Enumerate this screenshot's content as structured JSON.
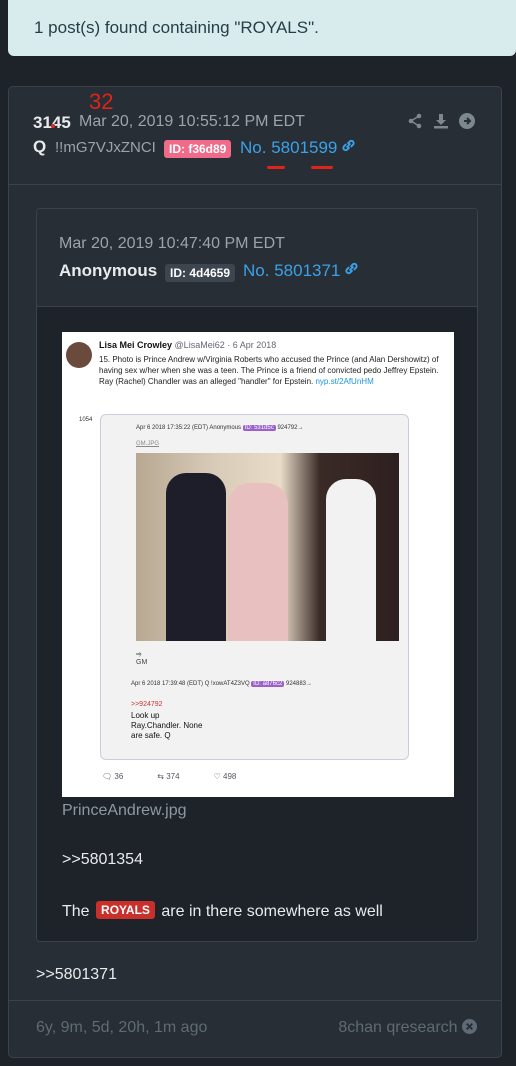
{
  "banner": {
    "text": "1 post(s) found containing \"ROYALS\"."
  },
  "post": {
    "number": "3145",
    "annotation_number": "32",
    "date": "Mar 20, 2019 10:55:12 PM EDT",
    "author": "Q",
    "tripcode": "!!mG7VJxZNCI",
    "id": "ID: f36d89",
    "post_no_label": "No.",
    "post_no": "5801599",
    "reply_link": ">>5801371",
    "footer_ago": "6y, 9m, 5d, 20h, 1m ago",
    "footer_source": "8chan qresearch"
  },
  "quoted": {
    "date": "Mar 20, 2019 10:47:40 PM EDT",
    "author": "Anonymous",
    "id": "ID: 4d4659",
    "post_no_label": "No.",
    "post_no": "5801371",
    "filename": "PrinceAndrew.jpg",
    "reply": ">>5801354",
    "text_before": "The",
    "highlight": "ROYALS",
    "text_after": "are in there somewhere as well"
  },
  "tweet": {
    "name": "Lisa Mei Crowley",
    "handle": "@LisaMei62 · 6 Apr 2018",
    "body": "15. Photo is Prince Andrew w/Virginia Roberts who accused the Prince (and Alan Dershowitz) of having sex w/her when she was a teen. The Prince is a friend of convicted pedo Jeffrey Epstein. Ray (Rachel) Chandler was an alleged \"handler\" for Epstein.",
    "link": "nyp.st/2AfUnHM",
    "card_no": "1054",
    "card_head": "Apr 6 2018 17:35:22 (EDT) Anonymous",
    "card_id": "ID: 531d5c",
    "card_ref": "924792→",
    "card_file": "GM.JPG",
    "gm_label": "GM",
    "reply_head": "Apr 6 2018 17:39:48 (EDT) Q !xowAT4Z3VQ",
    "reply_id": "ID: a876c2",
    "reply_ref": "924883→",
    "reply_quote": ">>924792",
    "reply_lines": "Look up Ray.Chandler. None are safe. Q",
    "replies": "36",
    "retweets": "374",
    "likes": "498"
  }
}
